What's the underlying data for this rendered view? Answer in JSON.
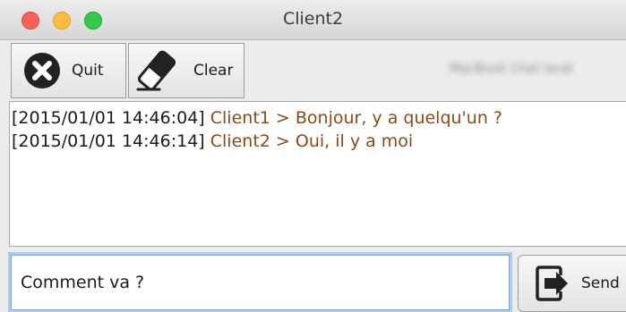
{
  "window": {
    "title": "Client2"
  },
  "toolbar": {
    "quit_label": "Quit",
    "clear_label": "Clear",
    "blurred_text": "MacBook Chat local"
  },
  "chat": {
    "messages": [
      {
        "timestamp": "[2015/01/01 14:46:04]",
        "sender": "Client1 >",
        "text": "Bonjour, y a quelqu'un ?"
      },
      {
        "timestamp": "[2015/01/01 14:46:14]",
        "sender": "Client2 >",
        "text": "Oui, il y a moi"
      }
    ]
  },
  "composer": {
    "value": "Comment va ?",
    "send_label": "Send"
  },
  "colors": {
    "sender_text": "#8a4b16",
    "close": "#fc605c",
    "minimize": "#fdbc40",
    "maximize": "#34c84a",
    "focus_ring": "#a9cbee"
  },
  "icons": {
    "quit": "close-circle-icon",
    "clear": "eraser-icon",
    "send": "exit-arrow-icon"
  }
}
